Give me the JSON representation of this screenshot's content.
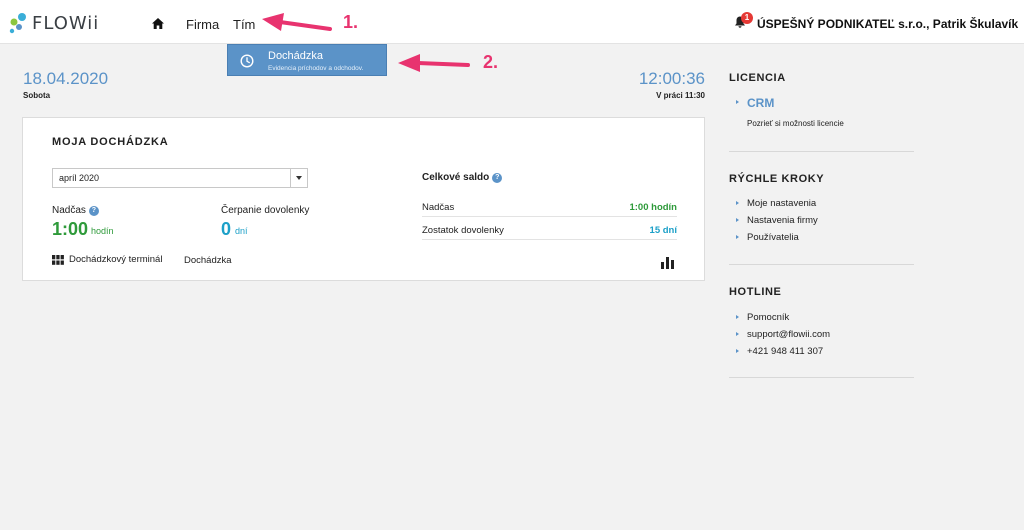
{
  "header": {
    "logo_text": "FLOWii",
    "nav": {
      "firma": "Firma",
      "tim": "Tím"
    },
    "notifications_count": "1",
    "user": "ÚSPEŠNÝ PODNIKATEĽ s.r.o., Patrik Škulavík"
  },
  "dropdown": {
    "title": "Dochádzka",
    "subtitle": "Evidencia príchodov a odchodov."
  },
  "datetime": {
    "date": "18.04.2020",
    "day": "Sobota",
    "time": "12:00:36",
    "in_work": "V práci 11:30"
  },
  "card": {
    "title": "MOJA DOCHÁDZKA",
    "month_select": "apríl 2020",
    "nadcas_label": "Nadčas",
    "nadcas_value": "1:00",
    "nadcas_unit": "hodín",
    "cerpanie_label": "Čerpanie dovolenky",
    "cerpanie_value": "0",
    "cerpanie_unit": "dní",
    "saldo_title": "Celkové saldo",
    "saldo_rows": [
      {
        "label": "Nadčas",
        "value": "1:00 hodín",
        "color": "#2e9a3a"
      },
      {
        "label": "Zostatok dovolenky",
        "value": "15 dní",
        "color": "#1ca0c8"
      }
    ],
    "terminal_link": "Dochádzkový terminál",
    "dochadzka_link": "Dochádzka"
  },
  "sidebar": {
    "licencia": {
      "heading": "LICENCIA",
      "crm": "CRM",
      "crm_sub": "Pozrieť si možnosti licencie"
    },
    "rychle_kroky": {
      "heading": "RÝCHLE KROKY",
      "items": [
        "Moje nastavenia",
        "Nastavenia firmy",
        "Používatelia"
      ]
    },
    "hotline": {
      "heading": "HOTLINE",
      "items": [
        "Pomocník",
        "support@flowii.com",
        "+421 948 411 307"
      ]
    }
  },
  "annotations": {
    "one": "1.",
    "two": "2."
  },
  "colors": {
    "accent": "#5b93c8",
    "green": "#2e9a3a",
    "teal": "#1ca0c8",
    "annotation": "#e8336f"
  }
}
